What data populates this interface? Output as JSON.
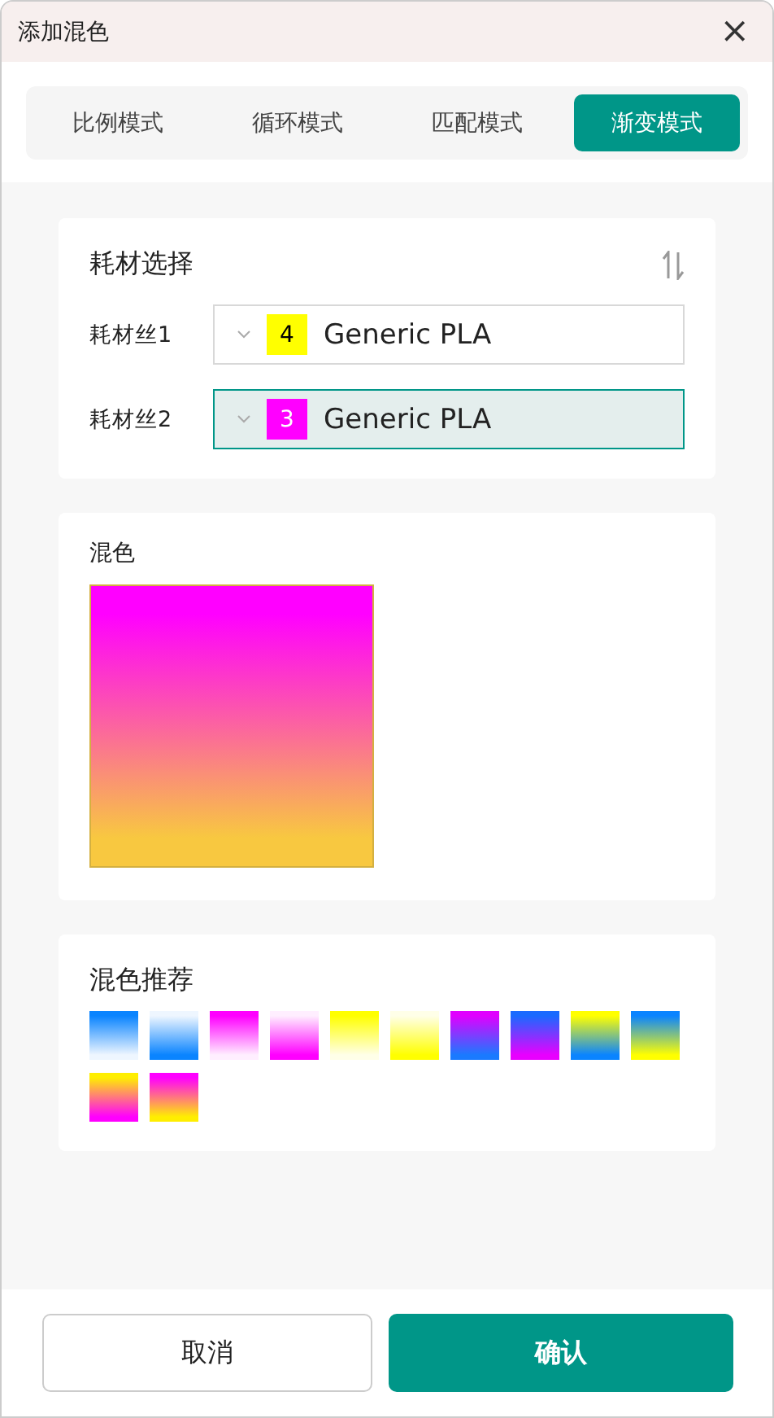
{
  "window": {
    "title": "添加混色",
    "close": "×"
  },
  "tabs": [
    {
      "label": "比例模式",
      "selected": false
    },
    {
      "label": "循环模式",
      "selected": false
    },
    {
      "label": "匹配模式",
      "selected": false
    },
    {
      "label": "渐变模式",
      "selected": true
    }
  ],
  "filament_section": {
    "title": "耗材选择",
    "filaments": [
      {
        "label": "耗材丝1",
        "number": "4",
        "color": "#ffff00",
        "name": "Generic PLA",
        "selected": false
      },
      {
        "label": "耗材丝2",
        "number": "3",
        "color": "#ff00ff",
        "name": "Generic PLA",
        "selected": true
      }
    ]
  },
  "mix_section": {
    "title": "混色",
    "stops": [
      {
        "color": "#ff00ff"
      },
      {
        "color": "#f8c840"
      }
    ]
  },
  "recommend_section": {
    "title": "混色推荐",
    "swatches": [
      {
        "stops": [
          {
            "color": "#0a84ff"
          },
          {
            "color": "#eef6ff"
          }
        ]
      },
      {
        "stops": [
          {
            "color": "#eef6ff"
          },
          {
            "color": "#0a84ff"
          }
        ]
      },
      {
        "stops": [
          {
            "color": "#ff00ff"
          },
          {
            "color": "#ffeeff"
          }
        ]
      },
      {
        "stops": [
          {
            "color": "#ffeeff"
          },
          {
            "color": "#ff00ff"
          }
        ]
      },
      {
        "stops": [
          {
            "color": "#ffff00"
          },
          {
            "color": "#ffffe8"
          }
        ]
      },
      {
        "stops": [
          {
            "color": "#ffffe8"
          },
          {
            "color": "#ffff00"
          }
        ]
      },
      {
        "stops": [
          {
            "color": "#e000ff"
          },
          {
            "color": "#1a7aff"
          }
        ]
      },
      {
        "stops": [
          {
            "color": "#1a6aff"
          },
          {
            "color": "#e800ff"
          }
        ]
      },
      {
        "stops": [
          {
            "color": "#ffff00"
          },
          {
            "color": "#0a84ff"
          }
        ]
      },
      {
        "stops": [
          {
            "color": "#0a84ff"
          },
          {
            "color": "#ffff00"
          }
        ]
      },
      {
        "stops": [
          {
            "color": "#ffee00"
          },
          {
            "color": "#ff00ff"
          }
        ]
      },
      {
        "stops": [
          {
            "color": "#ff00ff"
          },
          {
            "color": "#ffee00"
          }
        ]
      }
    ]
  },
  "buttons": [
    {
      "label": "取消",
      "kind": "secondary"
    },
    {
      "label": "确认",
      "kind": "primary"
    }
  ]
}
